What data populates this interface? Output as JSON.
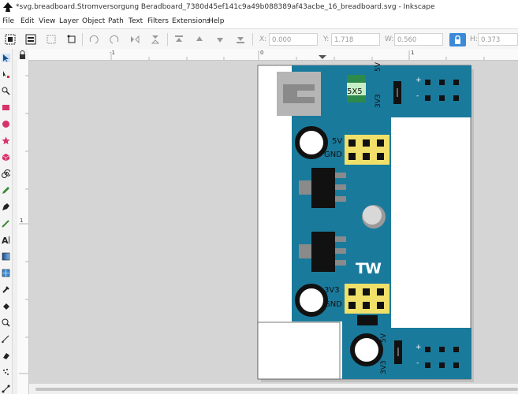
{
  "window": {
    "title": "*svg.breadboard.Stromversorgung Beradboard_7380d45ef141c9a49b088389af43acbe_16_breadboard.svg - Inkscape"
  },
  "menu": [
    "File",
    "Edit",
    "View",
    "Layer",
    "Object",
    "Path",
    "Text",
    "Filters",
    "Extensions",
    "Help"
  ],
  "toolbar": {
    "x_label": "X:",
    "x_value": "0.000",
    "y_label": "Y:",
    "y_value": "1.718",
    "w_label": "W:",
    "w_value": "0.560",
    "h_label": "H:",
    "h_value": "0.373"
  },
  "ruler": {
    "top_labels": [
      "-1",
      "0",
      "1"
    ],
    "left_labels": [
      "1"
    ]
  },
  "board": {
    "label_5x5": "5X5",
    "label_5v_top": "5V",
    "label_3v3_top": "3V3",
    "label_plus": "+",
    "label_minus": "-",
    "label_5v_mid": "5V",
    "label_gnd_mid": "GND",
    "label_tw": "TW",
    "label_3v3_low": "3V3",
    "label_gnd_low": "GND",
    "label_5v_bottom": "5V",
    "label_3v3_bottom": "3V3",
    "label_plus_bottom": "+",
    "label_minus_bottom": "-"
  },
  "colors": {
    "board": "#1a7a9c",
    "header": "#f0e06a",
    "accent": "#3b8ad8"
  }
}
